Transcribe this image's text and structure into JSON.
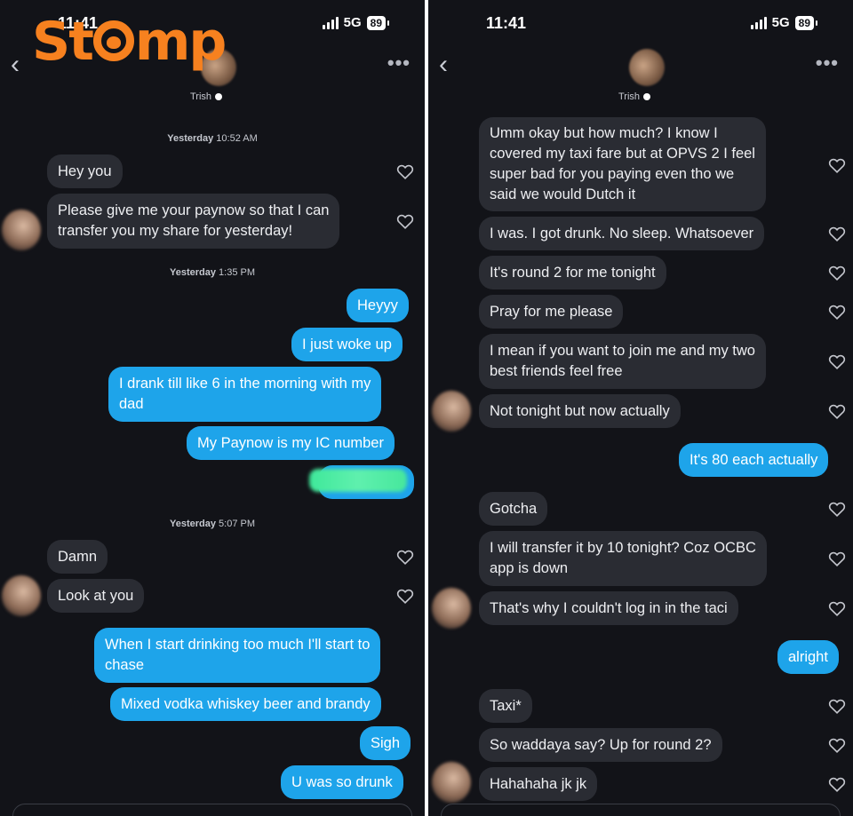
{
  "logo": {
    "text_before": "St",
    "text_after": "mp"
  },
  "left": {
    "status": {
      "time": "11:41",
      "network": "5G",
      "battery": "89"
    },
    "contact": {
      "name": "Trish"
    },
    "timestamps": [
      {
        "day": "Yesterday",
        "time": "10:52 AM"
      },
      {
        "day": "Yesterday",
        "time": "1:35 PM"
      },
      {
        "day": "Yesterday",
        "time": "5:07 PM"
      }
    ],
    "messages": [
      "Hey you",
      "Please give me your paynow so that I can",
      "transfer you my share for yesterday!",
      "Heyyy",
      "I just woke up",
      "I drank till like 6 in the morning with my",
      "dad",
      "My Paynow is my IC number",
      "Damn",
      "Look at you",
      "When I start drinking too much I'll start to",
      "chase",
      "Mixed vodka whiskey beer and brandy",
      "Sigh",
      "U was so drunk"
    ]
  },
  "right": {
    "status": {
      "time": "11:41",
      "network": "5G",
      "battery": "89"
    },
    "contact": {
      "name": "Trish"
    },
    "messages": [
      "Umm okay but how much? I know I",
      "covered my taxi fare but at OPVS 2 I feel",
      "super bad for you paying even tho we",
      "said we would Dutch it",
      "I was. I got drunk. No sleep. Whatsoever",
      "It's round 2 for me tonight",
      "Pray for me please",
      "I mean if you want to join me and my two",
      "best friends feel free",
      "Not tonight but now actually",
      "It's 80 each actually",
      "Gotcha",
      "I will transfer it by 10 tonight? Coz OCBC",
      "app is down",
      "That's why I couldn't log in in the taci",
      "alright",
      "Taxi*",
      "So waddaya say? Up for round 2?",
      "Hahahaha jk jk"
    ]
  },
  "icons": {
    "back": "‹",
    "more": "•••"
  },
  "colors": {
    "background": "#121318",
    "incoming": "#2a2c33",
    "outgoing": "#1ea4ea",
    "logo": "#f7811f"
  }
}
